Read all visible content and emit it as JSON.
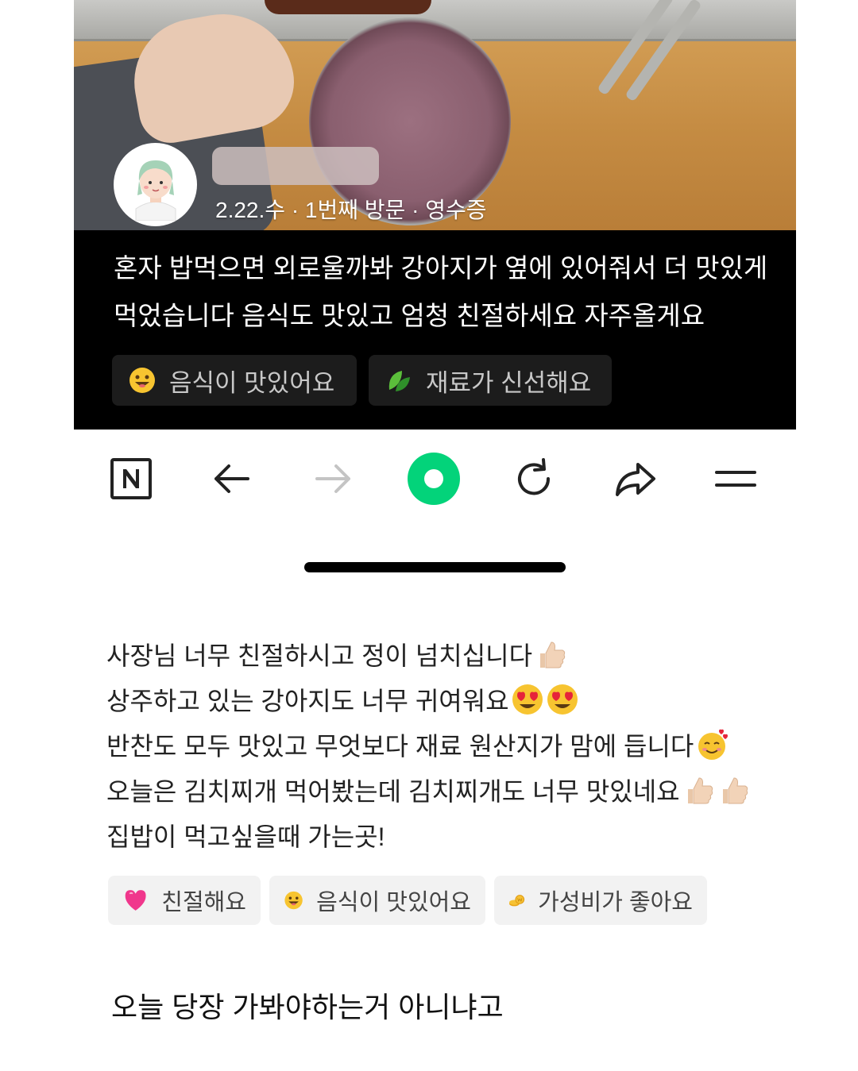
{
  "top_review": {
    "meta": "2.22.수 · 1번째 방문 · 영수증",
    "text_lines": [
      "혼자 밥먹으면 외로울까봐 강아지가 옆에 있어줘서 더 맛있게",
      "먹었습니다 음식도 맛있고 엄청 친절하세요 자주올게요"
    ],
    "chips": [
      {
        "label": "음식이 맛있어요",
        "icon": "smiley-face-icon"
      },
      {
        "label": "재료가 신선해요",
        "icon": "leaf-icon"
      }
    ]
  },
  "toolbar": {
    "items": [
      "naver-n-icon",
      "back-arrow-icon",
      "forward-arrow-icon",
      "green-home-icon",
      "refresh-icon",
      "share-icon",
      "menu-icon"
    ],
    "accent_color": "#03d37a"
  },
  "bottom_review": {
    "lines": [
      {
        "text": "사장님 너무 친절하시고 정이 넘치십니다",
        "emojis": [
          "thumbs-up-icon"
        ]
      },
      {
        "text": "상주하고 있는 강아지도 너무 귀여워요",
        "emojis": [
          "heart-eyes-icon",
          "heart-eyes-icon"
        ]
      },
      {
        "text": "반찬도 모두 맛있고 무엇보다 재료 원산지가 맘에 듭니다",
        "emojis": [
          "smiling-hearts-icon"
        ]
      },
      {
        "text": "오늘은 김치찌개 먹어봤는데 김치찌개도 너무 맛있네요",
        "emojis": [
          "thumbs-up-icon",
          "thumbs-up-icon"
        ]
      },
      {
        "text": "집밥이 먹고싶을때 가는곳!",
        "emojis": []
      }
    ],
    "chips": [
      {
        "label": "친절해요",
        "icon": "pink-heart-icon"
      },
      {
        "label": "음식이 맛있어요",
        "icon": "smiley-face-icon"
      },
      {
        "label": "가성비가 좋아요",
        "icon": "coins-icon"
      }
    ]
  },
  "caption": "오늘 당장 가봐야하는거 아니냐고"
}
